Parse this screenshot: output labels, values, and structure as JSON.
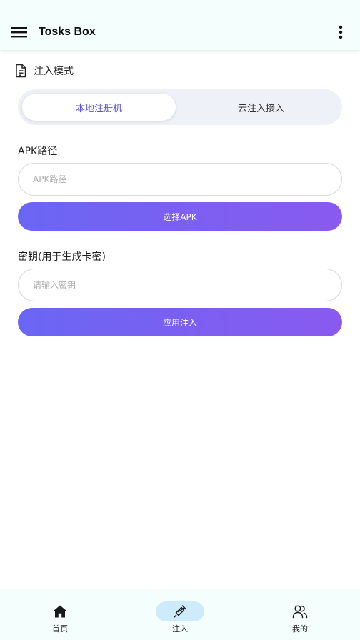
{
  "app": {
    "title": "Tosks Box"
  },
  "section": {
    "title": "注入模式"
  },
  "mode_toggle": {
    "options": [
      "本地注册机",
      "云注入接入"
    ],
    "selected": "本地注册机"
  },
  "apk": {
    "label": "APK路径",
    "placeholder": "APK路径",
    "button": "选择APK"
  },
  "key": {
    "label": "密钥(用于生成卡密)",
    "placeholder": "请输入密钥",
    "button": "应用注入"
  },
  "bottom_nav": {
    "items": [
      {
        "label": "首页",
        "icon": "home-icon"
      },
      {
        "label": "注入",
        "icon": "syringe-icon"
      },
      {
        "label": "我的",
        "icon": "users-icon"
      }
    ],
    "active": "注入"
  },
  "colors": {
    "accent": "#5b54d6",
    "gradient_start": "#6a66f4",
    "gradient_end": "#8a5af0",
    "bar_bg": "#f4fefd",
    "nav_active_pill": "#cdebfb"
  }
}
